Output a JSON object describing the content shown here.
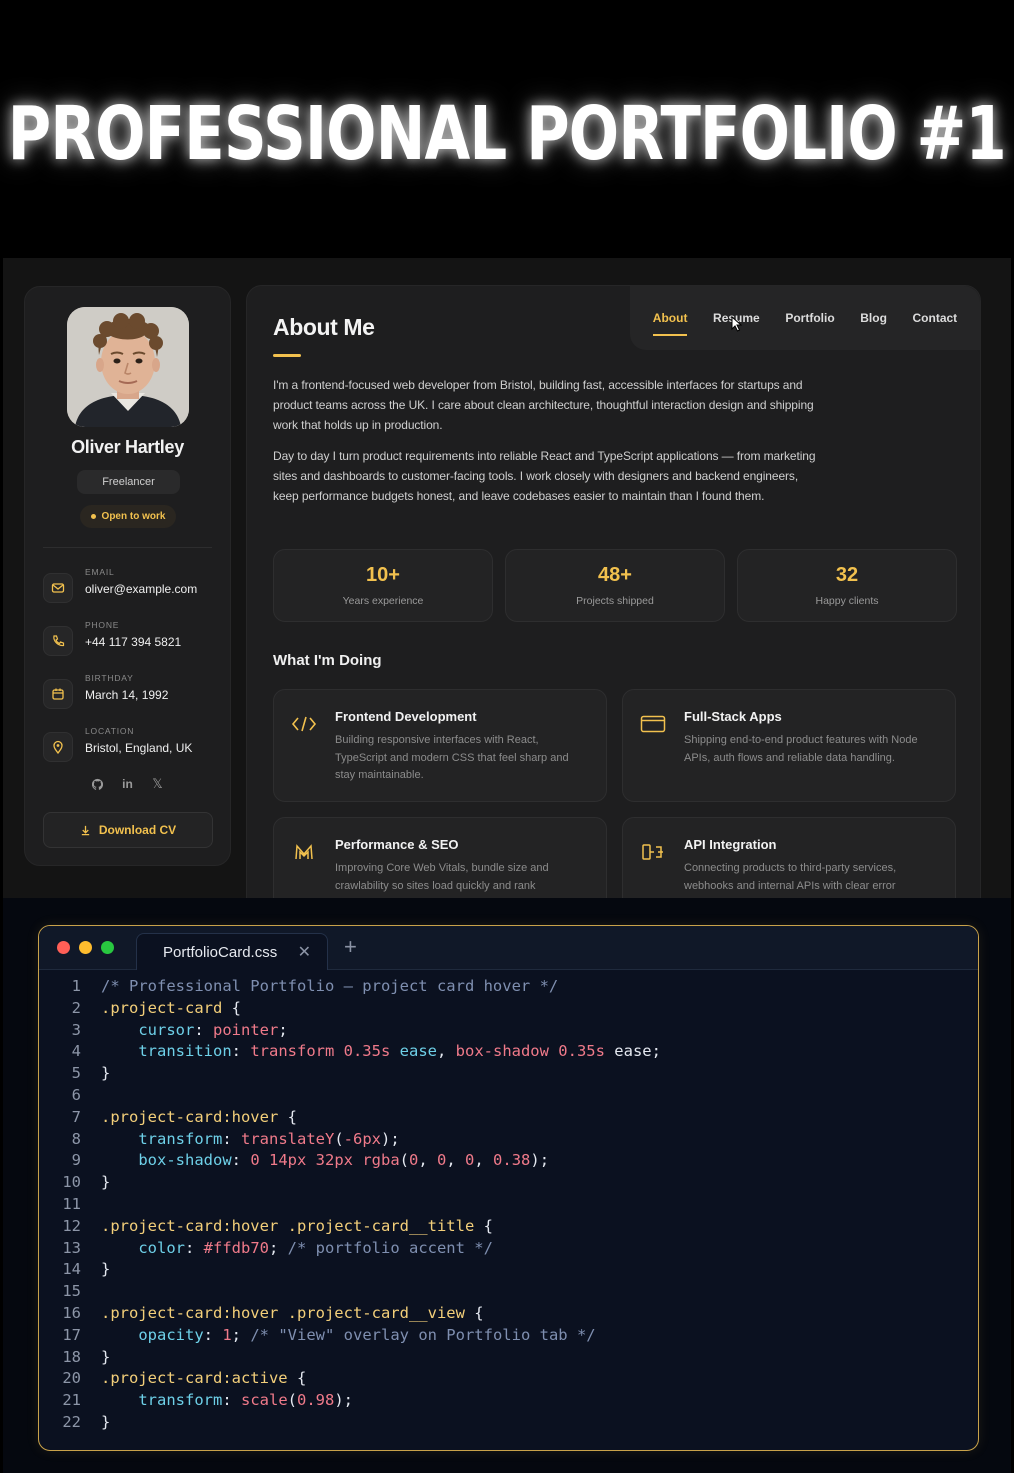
{
  "headline": "PROFESSIONAL PORTFOLIO #1",
  "profile": {
    "name": "Oliver Hartley",
    "role": "Freelancer",
    "status": "Open to work",
    "contacts": [
      {
        "label": "EMAIL",
        "value": "oliver@example.com",
        "icon": "mail-icon"
      },
      {
        "label": "PHONE",
        "value": "+44 117 394 5821",
        "icon": "phone-icon"
      },
      {
        "label": "BIRTHDAY",
        "value": "March 14, 1992",
        "icon": "calendar-icon"
      },
      {
        "label": "LOCATION",
        "value": "Bristol, England, UK",
        "icon": "location-pin-icon"
      }
    ],
    "socials": [
      "github-icon",
      "linkedin-icon",
      "x-icon"
    ],
    "socials_text": {
      "linkedin": "in",
      "x": "𝕏"
    },
    "download_label": "Download CV"
  },
  "nav": {
    "items": [
      "About",
      "Resume",
      "Portfolio",
      "Blog",
      "Contact"
    ],
    "active": "About"
  },
  "about": {
    "title": "About Me",
    "para1": "I'm a frontend-focused web developer from Bristol, building fast, accessible interfaces for startups and product teams across the UK. I care about clean architecture, thoughtful interaction design and shipping work that holds up in production.",
    "para2": "Day to day I turn product requirements into reliable React and TypeScript applications — from marketing sites and dashboards to customer-facing tools. I work closely with designers and backend engineers, keep performance budgets honest, and leave codebases easier to maintain than I found them.",
    "stats": [
      {
        "value": "10+",
        "caption": "Years experience"
      },
      {
        "value": "48+",
        "caption": "Projects shipped"
      },
      {
        "value": "32",
        "caption": "Happy clients"
      }
    ],
    "doing_title": "What I'm Doing",
    "services": [
      {
        "title": "Frontend Development",
        "desc": "Building responsive interfaces with React, TypeScript and modern CSS that feel sharp and stay maintainable.",
        "icon": "code-icon"
      },
      {
        "title": "Full-Stack Apps",
        "desc": "Shipping end-to-end product features with Node APIs, auth flows and reliable data handling.",
        "icon": "browser-window-icon"
      },
      {
        "title": "Performance & SEO",
        "desc": "Improving Core Web Vitals, bundle size and crawlability so sites load quickly and rank",
        "icon": "speedometer-m-icon"
      },
      {
        "title": "API Integration",
        "desc": "Connecting products to third-party services, webhooks and internal APIs with clear error",
        "icon": "plug-icon"
      }
    ]
  },
  "editor": {
    "tab_name": "PortfolioCard.css",
    "close_glyph": "✕",
    "plus_glyph": "+",
    "accent": "#c9a24a",
    "traffic_lights": [
      "#ff5f57",
      "#febc2e",
      "#28c840"
    ],
    "lines": [
      {
        "n": "1",
        "tokens": [
          [
            "com",
            "/* Professional Portfolio — project card hover */"
          ]
        ]
      },
      {
        "n": "2",
        "tokens": [
          [
            "sel",
            ".project-card"
          ],
          [
            "pun",
            " {"
          ]
        ]
      },
      {
        "n": "3",
        "tokens": [
          [
            "pun",
            "    "
          ],
          [
            "prop",
            "cursor"
          ],
          [
            "pun",
            ": "
          ],
          [
            "val",
            "pointer"
          ],
          [
            "pun",
            ";"
          ]
        ]
      },
      {
        "n": "4",
        "tokens": [
          [
            "pun",
            "    "
          ],
          [
            "prop",
            "transition"
          ],
          [
            "pun",
            ": "
          ],
          [
            "val",
            "transform 0.35s"
          ],
          [
            "pun",
            " "
          ],
          [
            "prop",
            "ease"
          ],
          [
            "pun",
            ", "
          ],
          [
            "val",
            "box-shadow 0.35s"
          ],
          [
            "pun",
            " ease;"
          ]
        ]
      },
      {
        "n": "5",
        "tokens": [
          [
            "pun",
            "}"
          ]
        ]
      },
      {
        "n": "6",
        "tokens": []
      },
      {
        "n": "7",
        "tokens": [
          [
            "sel",
            ".project-card:hover"
          ],
          [
            "pun",
            " {"
          ]
        ]
      },
      {
        "n": "8",
        "tokens": [
          [
            "pun",
            "    "
          ],
          [
            "prop",
            "transform"
          ],
          [
            "pun",
            ": "
          ],
          [
            "fn",
            "translateY"
          ],
          [
            "pun",
            "("
          ],
          [
            "val",
            "-6px"
          ],
          [
            "pun",
            ");"
          ]
        ]
      },
      {
        "n": "9",
        "tokens": [
          [
            "pun",
            "    "
          ],
          [
            "prop",
            "box-shadow"
          ],
          [
            "pun",
            ": "
          ],
          [
            "val",
            "0 14px 32px"
          ],
          [
            "pun",
            " "
          ],
          [
            "fn",
            "rgba"
          ],
          [
            "pun",
            "("
          ],
          [
            "val",
            "0"
          ],
          [
            "pun",
            ", "
          ],
          [
            "val",
            "0"
          ],
          [
            "pun",
            ", "
          ],
          [
            "val",
            "0"
          ],
          [
            "pun",
            ", "
          ],
          [
            "val",
            "0.38"
          ],
          [
            "pun",
            ");"
          ]
        ]
      },
      {
        "n": "10",
        "tokens": [
          [
            "pun",
            "}"
          ]
        ]
      },
      {
        "n": "11",
        "tokens": []
      },
      {
        "n": "12",
        "tokens": [
          [
            "sel",
            ".project-card:hover .project-card__title"
          ],
          [
            "pun",
            " {"
          ]
        ]
      },
      {
        "n": "13",
        "tokens": [
          [
            "pun",
            "    "
          ],
          [
            "prop",
            "color"
          ],
          [
            "pun",
            ": "
          ],
          [
            "val",
            "#ffdb70"
          ],
          [
            "pun",
            "; "
          ],
          [
            "com",
            "/* portfolio accent */"
          ]
        ]
      },
      {
        "n": "14",
        "tokens": [
          [
            "pun",
            "}"
          ]
        ]
      },
      {
        "n": "15",
        "tokens": []
      },
      {
        "n": "16",
        "tokens": [
          [
            "sel",
            ".project-card:hover .project-card__view"
          ],
          [
            "pun",
            " {"
          ]
        ]
      },
      {
        "n": "17",
        "tokens": [
          [
            "pun",
            "    "
          ],
          [
            "prop",
            "opacity"
          ],
          [
            "pun",
            ": "
          ],
          [
            "val",
            "1"
          ],
          [
            "pun",
            "; "
          ],
          [
            "com",
            "/* \"View\" overlay on Portfolio tab */"
          ]
        ]
      },
      {
        "n": "18",
        "tokens": [
          [
            "pun",
            "}"
          ]
        ]
      },
      {
        "n": "20",
        "tokens": [
          [
            "sel",
            ".project-card:active"
          ],
          [
            "pun",
            " {"
          ]
        ]
      },
      {
        "n": "21",
        "tokens": [
          [
            "pun",
            "    "
          ],
          [
            "prop",
            "transform"
          ],
          [
            "pun",
            ": "
          ],
          [
            "fn",
            "scale"
          ],
          [
            "pun",
            "("
          ],
          [
            "val",
            "0.98"
          ],
          [
            "pun",
            ");"
          ]
        ]
      },
      {
        "n": "22",
        "tokens": [
          [
            "pun",
            "}"
          ]
        ]
      }
    ]
  }
}
